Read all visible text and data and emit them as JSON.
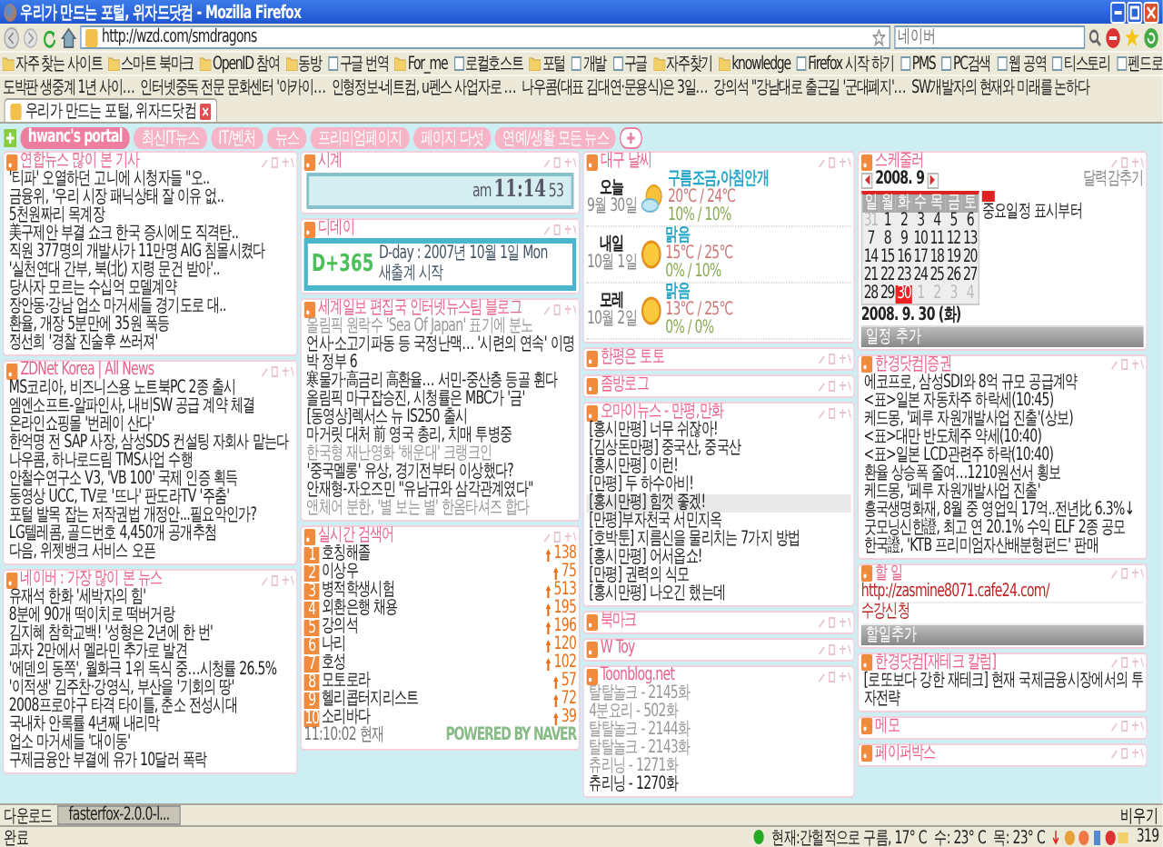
{
  "window": {
    "title": "우리가 만드는 포털, 위자드닷컴 - Mozilla Firefox"
  },
  "toolbar": {
    "url": "http://wzd.com/smdragons",
    "search_placeholder": "네이버"
  },
  "bookmarks": [
    {
      "label": "자주 찾는 사이트",
      "kind": "folder"
    },
    {
      "label": "스마트 북마크",
      "kind": "folder"
    },
    {
      "label": "OpenID 참여",
      "kind": "folder"
    },
    {
      "label": "동방",
      "kind": "folder"
    },
    {
      "label": "구글 번역",
      "kind": "page"
    },
    {
      "label": "For_me",
      "kind": "folder"
    },
    {
      "label": "로컬호스트",
      "kind": "page"
    },
    {
      "label": "포털",
      "kind": "folder"
    },
    {
      "label": "개발",
      "kind": "page"
    },
    {
      "label": "구글",
      "kind": "page"
    },
    {
      "label": "자주찾기",
      "kind": "folder"
    },
    {
      "label": "knowledge",
      "kind": "folder"
    },
    {
      "label": "Firefox 시작 하기",
      "kind": "page"
    },
    {
      "label": "PMS",
      "kind": "page"
    },
    {
      "label": "PC검색",
      "kind": "page"
    },
    {
      "label": "웹 공역",
      "kind": "page"
    },
    {
      "label": "티스토리",
      "kind": "page"
    },
    {
      "label": "펜드로",
      "kind": "page"
    }
  ],
  "headline_bookmarks": [
    "도박판 생중계 1년 사이…",
    "인터넷중독 전문 문화센터 '아카이…",
    "인형정보-네트컴, u펜스 사업자로 …",
    "나우콤(대표 김대연·문용식)은 3일…",
    "강의석 \"강남대로 출근길 '군대폐지'…",
    "SW개발자의 현재와 미래를 논하다"
  ],
  "browser_tabs": [
    {
      "label": "우리가 만드는 포털, 위자드닷컴",
      "selected": true
    }
  ],
  "portal_tabs": [
    {
      "label": "hwanc's portal",
      "selected": true
    },
    {
      "label": "최신IT뉴스",
      "selected": false
    },
    {
      "label": "IT/벤처",
      "selected": false
    },
    {
      "label": "뉴스",
      "selected": false
    },
    {
      "label": "프리미엄페이지",
      "selected": false
    },
    {
      "label": "페이지 다섯",
      "selected": false
    },
    {
      "label": "연예/생활 모든 뉴스",
      "selected": false
    }
  ],
  "columns": [
    [
      {
        "kind": "list",
        "title": "연합뉴스 많이 본 기사",
        "items": [
          "'티파' 오열하던 고니에 시청자들 \"오..",
          "금융위, '우리 시장 패닉상태 잘 이유 없..",
          "5천원짜리 목계장",
          "美구제안 부결 쇼크 한국 증시에도 직격탄..",
          "직원 377명의 개발사가 11만명 AIG 침몰시켰다",
          "'실천연대 간부, 북(北) 지령 문건 받아'..",
          "당사자 모르는 수십억 모델계약",
          "장안동·강남 업소 마거세들 경기도로 대..",
          "환율, 개장 5분만에 35원 폭등",
          "정선희 '경찰 진술후 쓰러져'"
        ]
      },
      {
        "kind": "list",
        "title": "ZDNet Korea | All News",
        "items": [
          "MS코리아, 비즈니스용 노트북PC 2종 출시",
          "엠엔소프트-알파인사, 내비SW 공급 계약 체결",
          "온라인쇼핑몰 '번레이 산다'",
          "한억명 전 SAP 사장, 삼성SDS 컨설팅 자회사 맡는다",
          "나우콤, 하나로드림 TMS사업 수행",
          "안철수연구소 V3, 'VB 100' 국제 인증 획득",
          "동영상 UCC, TV로 '뜨나' 판도라TV '주춤'",
          "포털 발목 잡는 저작권법 개정안...필요악인가?",
          "LG텔레콤, 골드번호 4,450개 공개추첨",
          "다음, 위젯뱅크 서비스 오픈"
        ]
      },
      {
        "kind": "list",
        "title": "네이버 : 가장 많이 본 뉴스",
        "items": [
          "유재석 한화 '세박자의 힘'",
          "8분에 90개 떡이치로 떡버거랑",
          "김지혜 참학교백! '성형은 2년에 한 번'",
          "과자 2만에서 멜라민 추가로 발견",
          "'에덴의 동쪽', 월화극 1위 독식 중…시청률 26.5%",
          "'이적생' 김주찬·강영식, 부산을 '기회의 땅'",
          "2008프로야구 타격 타이틀, 춘소 전성시대",
          "국내차 안록률 4년째 내리막",
          "업소 마거세들 '대이동'",
          "구제금융안 부결에 유가 10달러 폭락"
        ]
      }
    ],
    [
      {
        "kind": "clock",
        "title": "시계",
        "meridiem": "am",
        "time": "11:14",
        "seconds": "53"
      },
      {
        "kind": "dday",
        "title": "디데이",
        "count": "D+365",
        "date": "D-day : 2007년 10월 1일 Mon",
        "memo": "새출계 시작"
      },
      {
        "kind": "list",
        "title": "세계일보 편집국 인터넷뉴스팀 블로그",
        "items": [
          {
            "text": "올림픽 원락수 'Sea Of Japan' 표기에 분노",
            "muted": true
          },
          {
            "text": "언사·소고기파동 등 국정난맥… '시련의 연속' 이명박 정부 6",
            "muted": false
          },
          {
            "text": "寒물가·高금리 高환율… 서민-중산층 등골 휜다",
            "muted": false
          },
          {
            "text": "올림픽 마구잡승진, 시청률은 MBC가 '금'",
            "muted": false
          },
          {
            "text": "[동영상]렉서스 뉴 IS250 출시",
            "muted": false
          },
          {
            "text": "마거릿 대처 前 영국 총리, 치매 투병중",
            "muted": false
          },
          {
            "text": "한국형 재난영화 '해운대' 크랭크인",
            "muted": true
          },
          {
            "text": "'중국멜롱' 유상, 경기전부터 이상했다?",
            "muted": false
          },
          {
            "text": "안재형-자오즈민 \"유남규와 삼각관계였다\"",
            "muted": false
          },
          {
            "text": "앤체어 분한, '별 보는 별' 한옴타셔즈 합다",
            "muted": true
          }
        ]
      },
      {
        "kind": "ranking",
        "title": "실시간 검색어",
        "items": [
          {
            "rank": "1",
            "term": "호칭해졸",
            "count": "138"
          },
          {
            "rank": "2",
            "term": "이상우",
            "count": "75"
          },
          {
            "rank": "3",
            "term": "병적학생시험",
            "count": "513"
          },
          {
            "rank": "4",
            "term": "외환은행 채용",
            "count": "195"
          },
          {
            "rank": "5",
            "term": "강의석",
            "count": "196"
          },
          {
            "rank": "6",
            "term": "나리",
            "count": "120"
          },
          {
            "rank": "7",
            "term": "호성",
            "count": "102"
          },
          {
            "rank": "8",
            "term": "모토로라",
            "count": "57"
          },
          {
            "rank": "9",
            "term": "헬리콥터지리스트",
            "count": "72"
          },
          {
            "rank": "10",
            "term": "소리바다",
            "count": "39"
          }
        ],
        "time": "11:10:02 현재",
        "powered": "POWERED BY NAVER"
      }
    ],
    [
      {
        "kind": "weather",
        "title": "대구 날씨",
        "days": [
          {
            "day": "오늘",
            "date": "9월 30일",
            "kind": "cloudy",
            "condition": "구름조금,아침안개",
            "temp": "20℃ / 24℃",
            "rain": "10% / 10%"
          },
          {
            "day": "내일",
            "date": "10월 1일",
            "kind": "sunny",
            "condition": "맑음",
            "temp": "15℃ / 25℃",
            "rain": "0% / 10%"
          },
          {
            "day": "모레",
            "date": "10월 2일",
            "kind": "sunny",
            "condition": "맑음",
            "temp": "13℃ / 25℃",
            "rain": "0% / 0%"
          }
        ]
      },
      {
        "kind": "collapsed",
        "title": "한평은 토토"
      },
      {
        "kind": "collapsed",
        "title": "좀방로그"
      },
      {
        "kind": "list",
        "title": "오마이뉴스 - 만평,만화",
        "items": [
          {
            "text": "[홍시만평] 너무 쉬잖아!",
            "selected": false
          },
          {
            "text": "[김상돈만평] 중국산, 중국산",
            "selected": false
          },
          {
            "text": "[홍시만평] 이런!",
            "selected": false
          },
          {
            "text": "[만평] 두 하수아비!",
            "selected": false
          },
          {
            "text": "[홍시만평] 힘껏 좋겠!",
            "selected": true
          },
          {
            "text": "[만평]부자천국 서민지옥",
            "selected": false
          },
          {
            "text": "[호박툰] 지름신을 물리치는 7가지 방법",
            "selected": false
          },
          {
            "text": "[홍시만평] 어서옵쇼!",
            "selected": false
          },
          {
            "text": "[만평] 권력의 식모",
            "selected": false
          },
          {
            "text": "[홍시만평] 나오긴 했는데",
            "selected": false
          }
        ]
      },
      {
        "kind": "collapsed",
        "title": "북마크"
      },
      {
        "kind": "collapsed",
        "title": "W Toy"
      },
      {
        "kind": "list",
        "title": "Toonblog.net",
        "items": [
          {
            "text": "탈탈놀크 - 2145화",
            "muted": true
          },
          {
            "text": "4분요리 - 502화",
            "muted": true
          },
          {
            "text": "탈탈놀크 - 2144화",
            "muted": true
          },
          {
            "text": "탈탈놀크 - 2143화",
            "muted": true
          },
          {
            "text": "츄리닝 - 1271화",
            "muted": true
          },
          {
            "text": "츄리닝 - 1270화",
            "muted": false
          }
        ]
      }
    ],
    [
      {
        "kind": "calendar",
        "title": "스케줄러",
        "month": "2008. 9",
        "hide": "달력감추기",
        "legend": "중요일정 표시부터",
        "weekdays": [
          "일",
          "월",
          "화",
          "수",
          "목",
          "금",
          "토"
        ],
        "weeks": [
          [
            {
              "day": "31",
              "other_month": true,
              "selected": false
            },
            {
              "day": "1",
              "other_month": false,
              "selected": false
            },
            {
              "day": "2",
              "other_month": false,
              "selected": false
            },
            {
              "day": "3",
              "other_month": false,
              "selected": false
            },
            {
              "day": "4",
              "other_month": false,
              "selected": false
            },
            {
              "day": "5",
              "other_month": false,
              "selected": false
            },
            {
              "day": "6",
              "other_month": false,
              "selected": false
            }
          ],
          [
            {
              "day": "7",
              "other_month": false,
              "selected": false
            },
            {
              "day": "8",
              "other_month": false,
              "selected": false
            },
            {
              "day": "9",
              "other_month": false,
              "selected": false
            },
            {
              "day": "10",
              "other_month": false,
              "selected": false
            },
            {
              "day": "11",
              "other_month": false,
              "selected": false
            },
            {
              "day": "12",
              "other_month": false,
              "selected": false
            },
            {
              "day": "13",
              "other_month": false,
              "selected": false
            }
          ],
          [
            {
              "day": "14",
              "other_month": false,
              "selected": false
            },
            {
              "day": "15",
              "other_month": false,
              "selected": false
            },
            {
              "day": "16",
              "other_month": false,
              "selected": false
            },
            {
              "day": "17",
              "other_month": false,
              "selected": false
            },
            {
              "day": "18",
              "other_month": false,
              "selected": false
            },
            {
              "day": "19",
              "other_month": false,
              "selected": false
            },
            {
              "day": "20",
              "other_month": false,
              "selected": false
            }
          ],
          [
            {
              "day": "21",
              "other_month": false,
              "selected": false
            },
            {
              "day": "22",
              "other_month": false,
              "selected": false
            },
            {
              "day": "23",
              "other_month": false,
              "selected": false
            },
            {
              "day": "24",
              "other_month": false,
              "selected": false
            },
            {
              "day": "25",
              "other_month": false,
              "selected": false
            },
            {
              "day": "26",
              "other_month": false,
              "selected": false
            },
            {
              "day": "27",
              "other_month": false,
              "selected": false
            }
          ],
          [
            {
              "day": "28",
              "other_month": false,
              "selected": false
            },
            {
              "day": "29",
              "other_month": false,
              "selected": false
            },
            {
              "day": "30",
              "other_month": false,
              "selected": true
            },
            {
              "day": "1",
              "other_month": true,
              "selected": false
            },
            {
              "day": "2",
              "other_month": true,
              "selected": false
            },
            {
              "day": "3",
              "other_month": true,
              "selected": false
            },
            {
              "day": "4",
              "other_month": true,
              "selected": false
            }
          ]
        ],
        "selected_date": "2008. 9. 30 (화)",
        "add": "일정 추가"
      },
      {
        "kind": "list",
        "title": "한경닷컴|증권",
        "items": [
          "에코프로, 삼성SDI와 8억 규모 공급계약",
          "<표>일본 자동차주 하락세(10:45)",
          "케드몽, '페루 자원개발사업 진출'(상보)",
          "<표>대만 반도체주 약세(10:40)",
          "<표>일본 LCD관련주 하락(10:40)",
          "환율 상승폭 줄여…1210원선서 횡보",
          "케드몽, '페루 자원개발사업 진출'",
          "흥국생명화재, 8월 중 영업익 17억..전년比 6.3%↓",
          "굿모닝신한證, 최고 연 20.1% 수익 ELF 2종 공모",
          "한국證, 'KTB 프리미엄자산배분형펀드' 판매"
        ]
      },
      {
        "kind": "todo",
        "title": "할 일",
        "items": [
          "http://zasmine8071.cafe24.com/",
          "수강신청"
        ],
        "add": "할일추가"
      },
      {
        "kind": "list",
        "title": "한경닷컴[재테크 칼럼]",
        "items": [
          "[로또보다 강한 재테크] 현재 국제금융시장에서의 투자전략"
        ]
      },
      {
        "kind": "collapsed",
        "title": "메모"
      },
      {
        "kind": "collapsed",
        "title": "페이퍼박스"
      }
    ]
  ],
  "downloads": {
    "label": "다운로드",
    "file": "fasterfox-2.0.0-l...",
    "clear": "비우기"
  },
  "status_bar": {
    "status": "완료",
    "weather": [
      "현재:간헐적으로 구름, 17° C",
      "수: 23° C",
      "목: 23° C"
    ],
    "count": "319"
  }
}
